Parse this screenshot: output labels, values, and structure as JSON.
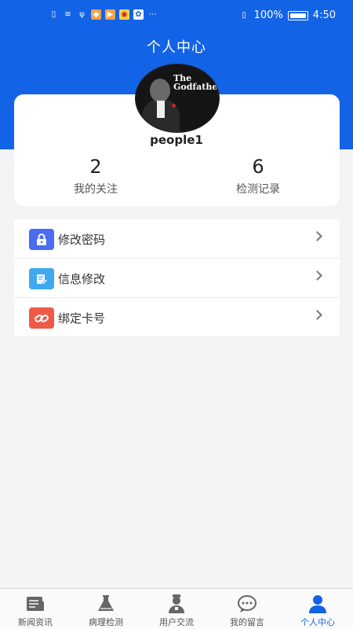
{
  "status_bar": {
    "battery_percent": "100%",
    "time": "4:50"
  },
  "header": {
    "title": "个人中心"
  },
  "profile": {
    "avatar_text": "The Godfather",
    "username": "people1",
    "stats": [
      {
        "value": "2",
        "label": "我的关注"
      },
      {
        "value": "6",
        "label": "检测记录"
      }
    ]
  },
  "menu": {
    "items": [
      {
        "label": "修改密码",
        "icon": "lock-icon",
        "color": "#4a6cf0"
      },
      {
        "label": "信息修改",
        "icon": "edit-note-icon",
        "color": "#3fa8ee"
      },
      {
        "label": "绑定卡号",
        "icon": "link-icon",
        "color": "#ee5a48"
      }
    ]
  },
  "tabbar": {
    "active_color": "#1263e6",
    "items": [
      {
        "label": "新闻资讯",
        "icon": "news-icon"
      },
      {
        "label": "病理检测",
        "icon": "flask-icon"
      },
      {
        "label": "用户交流",
        "icon": "doctor-icon"
      },
      {
        "label": "我的留言",
        "icon": "chat-bubble-icon"
      },
      {
        "label": "个人中心",
        "icon": "person-icon",
        "active": true
      }
    ]
  }
}
